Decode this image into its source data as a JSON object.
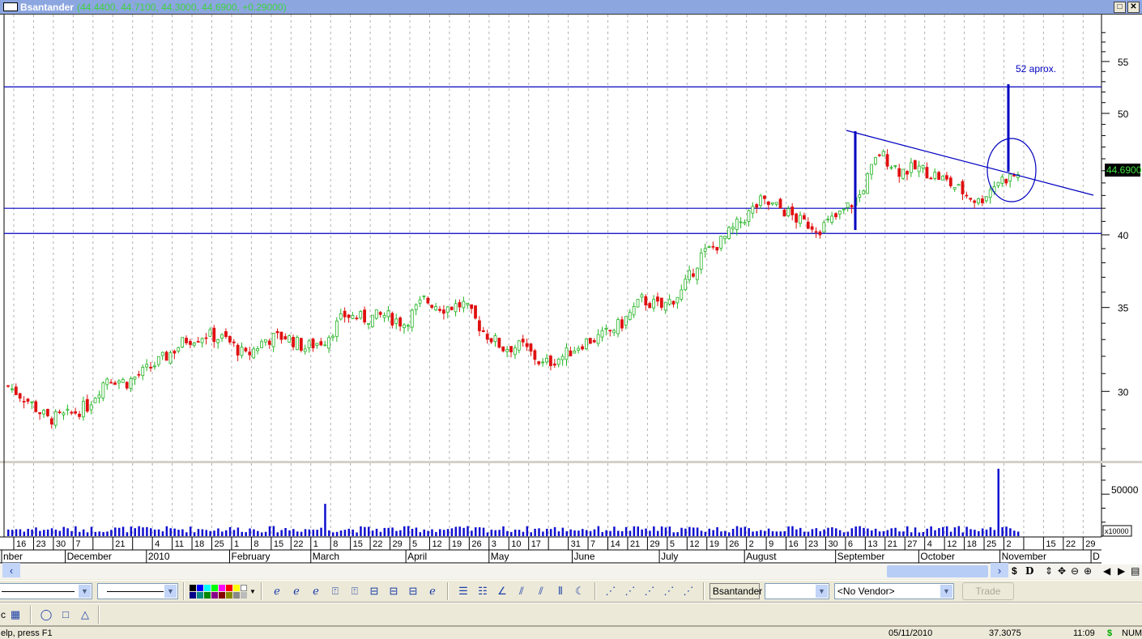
{
  "window": {
    "title": "Bsantander",
    "ohlc_text": "(44.4400, 44.7100, 44.3000, 44.6900, +0.29000)",
    "maximize": "□",
    "close": "✕"
  },
  "colors": {
    "up": "#22b422",
    "down": "#e01010",
    "line": "#0000c0",
    "volume": "#1010d0",
    "grid": "#b0b0b0",
    "last_bg": "#000000",
    "last_fg": "#40e040"
  },
  "chart_data": {
    "type": "candlestick",
    "symbol": "Bsantander",
    "scale": "log",
    "y_ticks": [
      30,
      35,
      40,
      50,
      55
    ],
    "last_price_label": "44.6900",
    "weekly_closes": [
      30.3,
      29.5,
      28.5,
      28.7,
      29.2,
      30.8,
      30.5,
      31.2,
      32.0,
      33.0,
      33.3,
      33.0,
      32.0,
      33.0,
      33.2,
      32.5,
      33.0,
      34.5,
      34.3,
      34.5,
      34.0,
      35.5,
      35.0,
      35.2,
      33.5,
      32.5,
      32.6,
      31.5,
      32.0,
      32.8,
      33.2,
      34.0,
      35.5,
      35.0,
      36.0,
      38.5,
      39.5,
      41.0,
      42.5,
      42.0,
      41.0,
      40.5,
      41.5,
      43.0,
      46.5,
      45.0,
      45.2,
      44.5,
      43.5,
      42.5,
      44.2,
      44.69
    ],
    "horizontal_lines": [
      52.5,
      42.0,
      40.1
    ],
    "annotation": "52 aprox.",
    "volume": {
      "unit_label": "x10000",
      "tick": "50000",
      "typical": [
        4000,
        11000
      ],
      "spikes": [
        {
          "week": 16,
          "value": 35000
        },
        {
          "week": 50,
          "value": 73000
        }
      ]
    },
    "week_labels": [
      "16",
      "23",
      "30",
      "7",
      "",
      "21",
      "",
      "4",
      "11",
      "18",
      "25",
      "1",
      "8",
      "15",
      "22",
      "1",
      "8",
      "15",
      "22",
      "29",
      "5",
      "12",
      "19",
      "26",
      "3",
      "10",
      "17",
      "",
      "31",
      "7",
      "14",
      "21",
      "29",
      "5",
      "12",
      "19",
      "26",
      "2",
      "9",
      "16",
      "23",
      "30",
      "6",
      "13",
      "21",
      "27",
      "4",
      "12",
      "18",
      "25",
      "2",
      "",
      "15",
      "22",
      "29"
    ],
    "months": [
      {
        "label": "nber",
        "week": -1
      },
      {
        "label": "December",
        "week": 2.6
      },
      {
        "label": "2010",
        "week": 6.7
      },
      {
        "label": "February",
        "week": 10.9
      },
      {
        "label": "March",
        "week": 15
      },
      {
        "label": "April",
        "week": 19.8
      },
      {
        "label": "May",
        "week": 24
      },
      {
        "label": "June",
        "week": 28.2
      },
      {
        "label": "July",
        "week": 32.6
      },
      {
        "label": "August",
        "week": 36.9
      },
      {
        "label": "September",
        "week": 41.5
      },
      {
        "label": "October",
        "week": 45.7
      },
      {
        "label": "November",
        "week": 49.8
      },
      {
        "label": "D",
        "week": 54.4
      }
    ]
  },
  "toolbar": {
    "symbol": "Bsantander",
    "vendor": "<No Vendor>",
    "trade": "Trade",
    "period": ""
  },
  "nav": {
    "dollar": "$",
    "d": "D"
  },
  "status": {
    "help": "elp, press F1",
    "date": "05/11/2010",
    "value": "37.3075",
    "time": "11:09",
    "dollar": "$",
    "num": "NUM"
  }
}
